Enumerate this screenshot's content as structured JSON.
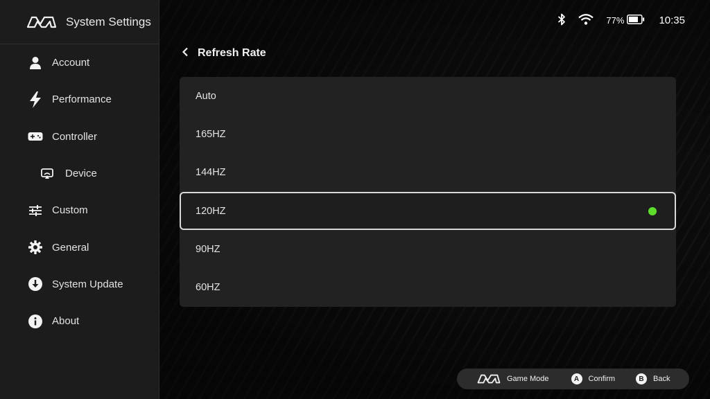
{
  "brand": {
    "title": "System Settings",
    "logo_icon": "mm-logo-icon"
  },
  "status_bar": {
    "bluetooth_icon": "bluetooth-icon",
    "wifi_icon": "wifi-icon",
    "battery_percent": "77%",
    "battery_icon": "battery-icon",
    "time": "10:35"
  },
  "sidebar": {
    "items": [
      {
        "label": "Account",
        "icon": "person-icon"
      },
      {
        "label": "Performance",
        "icon": "lightning-icon"
      },
      {
        "label": "Controller",
        "icon": "gamepad-icon"
      },
      {
        "label": "Device",
        "icon": "cast-icon"
      },
      {
        "label": "Custom",
        "icon": "sliders-icon"
      },
      {
        "label": "General",
        "icon": "gear-icon"
      },
      {
        "label": "System Update",
        "icon": "download-icon"
      },
      {
        "label": "About",
        "icon": "info-icon"
      }
    ]
  },
  "header": {
    "title": "Refresh Rate",
    "back_icon": "chevron-left-icon"
  },
  "refresh_rate": {
    "options": [
      "Auto",
      "165HZ",
      "144HZ",
      "120HZ",
      "90HZ",
      "60HZ"
    ],
    "selected": "120HZ",
    "selected_indicator_color": "#5ddc2c"
  },
  "hints": {
    "game_mode": "Game Mode",
    "confirm_key": "A",
    "confirm": "Confirm",
    "back_key": "B",
    "back": "Back"
  }
}
